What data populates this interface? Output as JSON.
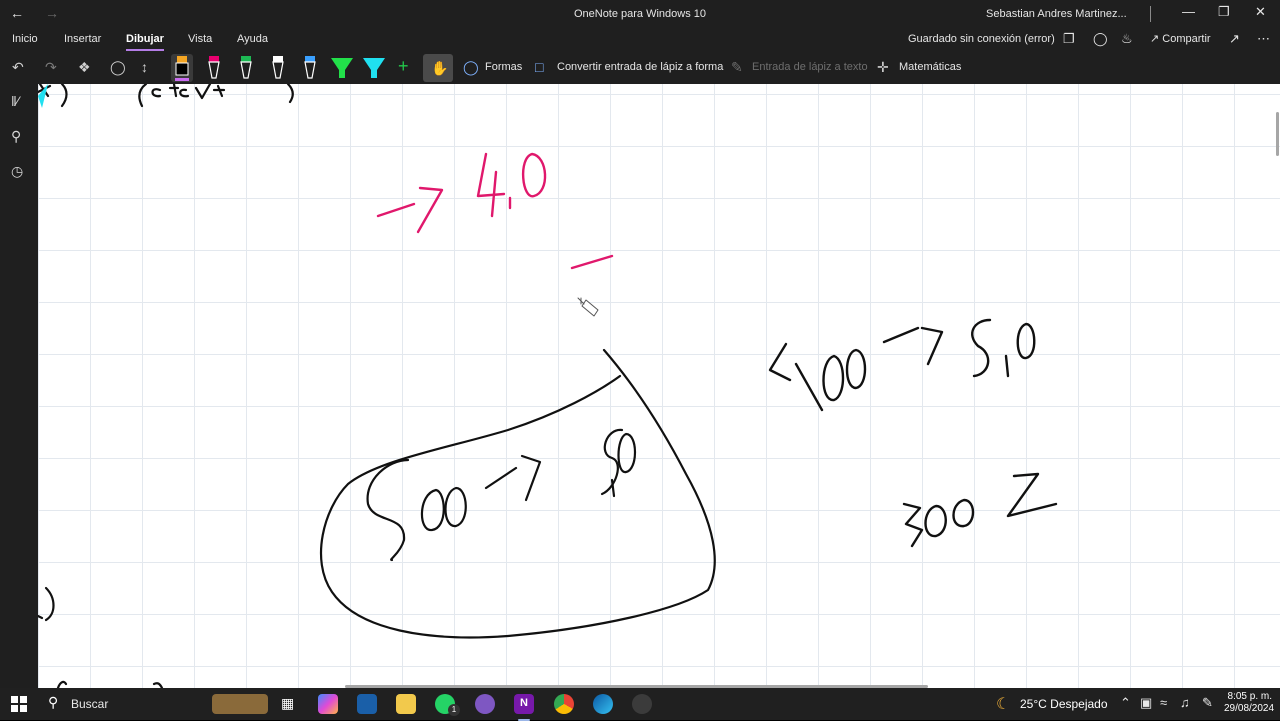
{
  "window": {
    "title": "OneNote para Windows 10",
    "user": "Sebastian Andres Martinez..."
  },
  "menu": {
    "items": [
      "Inicio",
      "Insertar",
      "Dibujar",
      "Vista",
      "Ayuda"
    ],
    "active": "Dibujar",
    "sync_status": "Guardado sin conexión (error)",
    "share_label": "Compartir"
  },
  "ribbon": {
    "shapes_label": "Formas",
    "ink_to_shape_label": "Convertir entrada de lápiz a forma",
    "ink_to_text_label": "Entrada de lápiz a texto",
    "math_label": "Matemáticas",
    "pens": [
      {
        "name": "pen-black",
        "color": "#000000",
        "selected": true
      },
      {
        "name": "pen-pink",
        "color": "#e8006f"
      },
      {
        "name": "pen-green",
        "color": "#1db954"
      },
      {
        "name": "pen-white",
        "color": "#ffffff"
      },
      {
        "name": "pen-blue",
        "color": "#3aa0ff"
      },
      {
        "name": "highlighter-green",
        "color": "#22e04a"
      },
      {
        "name": "highlighter-cyan",
        "color": "#20e0f0"
      }
    ]
  },
  "ink": {
    "pink_color": "#e0186c",
    "black_color": "#111111"
  },
  "taskbar": {
    "search_label": "Buscar",
    "weather_label": "25°C  Despejado",
    "time": "8:05 p. m.",
    "date": "29/08/2024",
    "whatsapp_badge": "1"
  }
}
